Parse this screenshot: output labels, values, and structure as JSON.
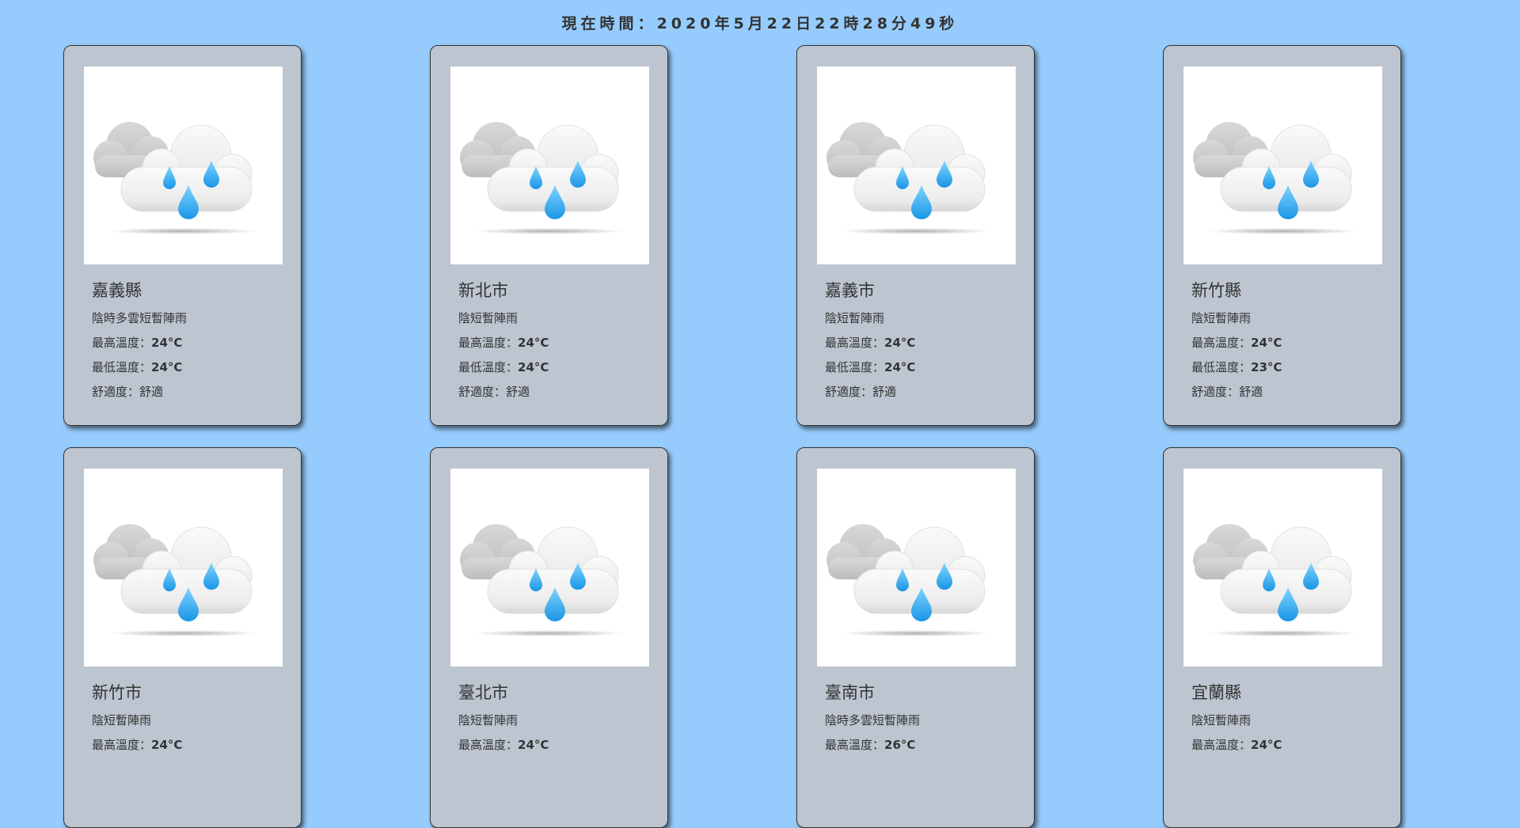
{
  "clock": {
    "prefix": "現在時間：",
    "value": "2020年5月22日22時28分49秒"
  },
  "labels": {
    "max_temp": "最高溫度：",
    "min_temp": "最低溫度：",
    "comfort": "舒適度："
  },
  "cards": [
    {
      "city": "嘉義縣",
      "weather": "陰時多雲短暫陣雨",
      "max_temp": "24°C",
      "min_temp": "24°C",
      "comfort": "舒適",
      "icon": "cloud-rain-icon"
    },
    {
      "city": "新北市",
      "weather": "陰短暫陣雨",
      "max_temp": "24°C",
      "min_temp": "24°C",
      "comfort": "舒適",
      "icon": "cloud-rain-icon"
    },
    {
      "city": "嘉義市",
      "weather": "陰短暫陣雨",
      "max_temp": "24°C",
      "min_temp": "24°C",
      "comfort": "舒適",
      "icon": "cloud-rain-icon"
    },
    {
      "city": "新竹縣",
      "weather": "陰短暫陣雨",
      "max_temp": "24°C",
      "min_temp": "23°C",
      "comfort": "舒適",
      "icon": "cloud-rain-icon"
    },
    {
      "city": "新竹市",
      "weather": "陰短暫陣雨",
      "max_temp": "24°C",
      "icon": "cloud-rain-icon"
    },
    {
      "city": "臺北市",
      "weather": "陰短暫陣雨",
      "max_temp": "24°C",
      "icon": "cloud-rain-icon"
    },
    {
      "city": "臺南市",
      "weather": "陰時多雲短暫陣雨",
      "max_temp": "26°C",
      "icon": "cloud-rain-icon"
    },
    {
      "city": "宜蘭縣",
      "weather": "陰短暫陣雨",
      "max_temp": "24°C",
      "icon": "cloud-rain-icon"
    }
  ],
  "colors": {
    "background": "#96ccfd",
    "card": "#bcc5d0",
    "rain_drop": "#29a9f0"
  }
}
